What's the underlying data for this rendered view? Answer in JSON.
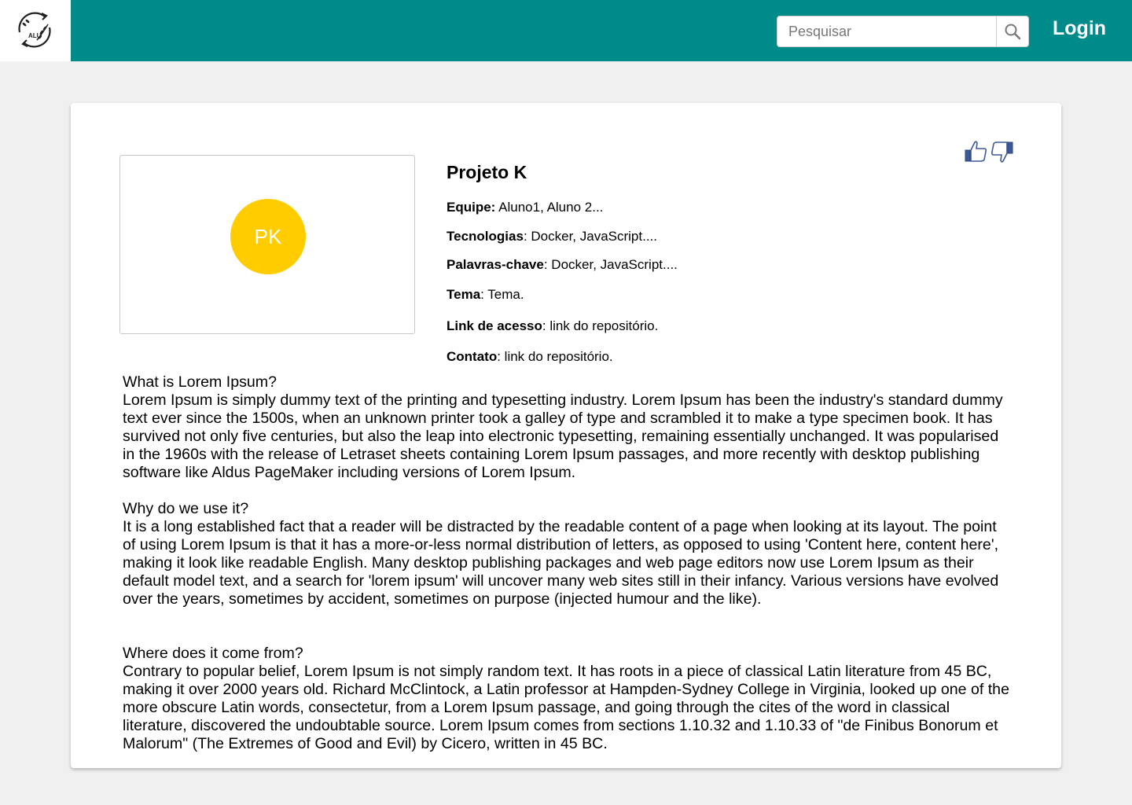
{
  "header": {
    "logo_text": "ALU",
    "search_placeholder": "Pesquisar",
    "search_value": "",
    "login_label": "Login",
    "brand_color": "#008b8b"
  },
  "project": {
    "avatar_initials": "PK",
    "avatar_color": "#ffcc00",
    "title": "Projeto K",
    "fields": [
      {
        "label": "Equipe:",
        "sep": "",
        "value": " Aluno1,  Aluno 2..."
      },
      {
        "label": "Tecnologias",
        "sep": ":",
        "value": " Docker, JavaScript...."
      },
      {
        "label": "Palavras-chave",
        "sep": ":",
        "value": " Docker, JavaScript...."
      },
      {
        "label": "Tema",
        "sep": ":",
        "value": " Tema."
      },
      {
        "label": "Link de acesso",
        "sep": ":",
        "value": " link do repositório."
      },
      {
        "label": "Contato",
        "sep": ":",
        "value": " link do repositório."
      }
    ],
    "vote_icons": [
      "thumbs-up-icon",
      "thumbs-down-icon"
    ]
  },
  "description": [
    {
      "heading": "What is Lorem Ipsum?",
      "body": "Lorem Ipsum is simply dummy text of the printing and typesetting industry. Lorem Ipsum has been the industry's standard dummy text ever since the 1500s, when an unknown printer took a galley of type and scrambled it to make a type specimen book. It has survived not only five centuries, but also the leap into electronic typesetting, remaining essentially unchanged. It was popularised in the 1960s with the release of Letraset sheets containing Lorem Ipsum passages, and more recently with desktop publishing software like Aldus PageMaker including versions of Lorem Ipsum."
    },
    {
      "heading": "Why do we use it?",
      "body": "It is a long established fact that a reader will be distracted by the readable content of a page when looking at its layout. The point of using Lorem Ipsum is that it has a more-or-less normal distribution of letters, as opposed to using 'Content here, content here', making it look like readable English. Many desktop publishing packages and web page editors now use Lorem Ipsum as their default model text, and a search for 'lorem ipsum' will uncover many web sites still in their infancy. Various versions have evolved over the years, sometimes by accident, sometimes on purpose (injected humour and the like)."
    },
    {
      "heading": "Where does it come from?",
      "body": "Contrary to popular belief, Lorem Ipsum is not simply random text. It has roots in a piece of classical Latin literature from 45 BC, making it over 2000 years old. Richard McClintock, a Latin professor at Hampden-Sydney College in Virginia, looked up one of the more obscure Latin words, consectetur, from a Lorem Ipsum passage, and going through the cites of the word in classical literature, discovered the undoubtable source. Lorem Ipsum comes from sections 1.10.32 and 1.10.33 of \"de Finibus Bonorum et Malorum\" (The Extremes of Good and Evil) by Cicero, written in 45 BC."
    }
  ]
}
